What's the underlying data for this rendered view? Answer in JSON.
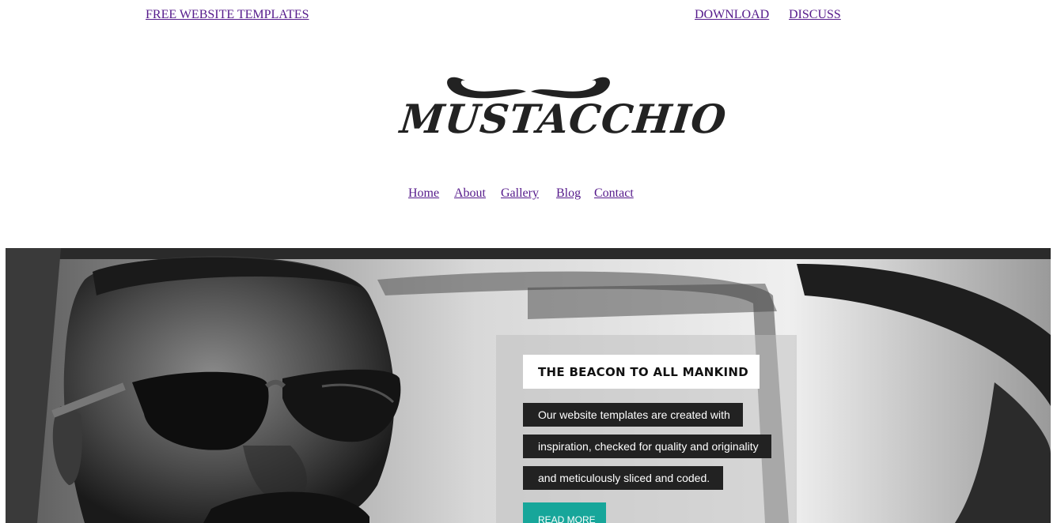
{
  "top_bar": {
    "free_templates": "FREE WEBSITE TEMPLATES",
    "download": "DOWNLOAD",
    "discuss": "DISCUSS"
  },
  "logo": {
    "text": "MUSTACCHIO"
  },
  "nav": {
    "items": [
      {
        "label": "Home"
      },
      {
        "label": "About"
      },
      {
        "label": "Gallery"
      },
      {
        "label": "Blog"
      },
      {
        "label": "Contact"
      }
    ]
  },
  "hero": {
    "title": "THE BEACON TO ALL MANKIND",
    "lines": [
      "Our website templates are created with",
      "inspiration, checked for quality and originality",
      "and meticulously sliced and coded."
    ],
    "cta": "READ MORE"
  },
  "colors": {
    "link": "#551a8b",
    "accent": "#17a69a",
    "caption_bg": "#222222"
  }
}
